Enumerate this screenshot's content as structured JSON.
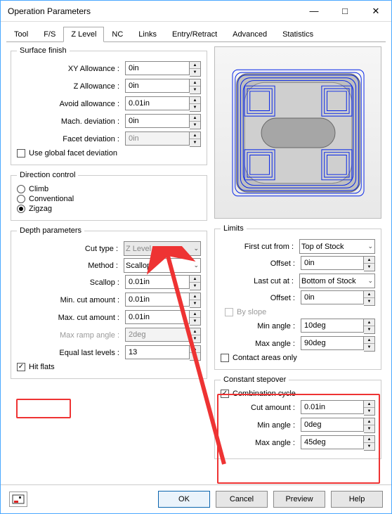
{
  "window": {
    "title": "Operation Parameters",
    "min": "—",
    "max": "□",
    "close": "✕"
  },
  "tabs": [
    "Tool",
    "F/S",
    "Z Level",
    "NC",
    "Links",
    "Entry/Retract",
    "Advanced",
    "Statistics"
  ],
  "active_tab": 2,
  "surface_finish": {
    "legend": "Surface finish",
    "xy_allow": {
      "label": "XY Allowance :",
      "value": "0in"
    },
    "z_allow": {
      "label": "Z Allowance :",
      "value": "0in"
    },
    "avoid": {
      "label": "Avoid allowance :",
      "value": "0.01in"
    },
    "mach_dev": {
      "label": "Mach. deviation :",
      "value": "0in"
    },
    "facet_dev": {
      "label": "Facet deviation :",
      "value": "0in"
    },
    "use_global": {
      "label": "Use global facet deviation",
      "checked": false
    }
  },
  "direction": {
    "legend": "Direction control",
    "opts": [
      "Climb",
      "Conventional",
      "Zigzag"
    ],
    "selected": 2
  },
  "depth": {
    "legend": "Depth parameters",
    "cut_type": {
      "label": "Cut type :",
      "value": "Z Level"
    },
    "method": {
      "label": "Method :",
      "value": "Scallop"
    },
    "scallop": {
      "label": "Scallop :",
      "value": "0.01in"
    },
    "min_cut": {
      "label": "Min. cut amount :",
      "value": "0.01in"
    },
    "max_cut": {
      "label": "Max. cut amount :",
      "value": "0.01in"
    },
    "max_ramp": {
      "label": "Max ramp angle :",
      "value": "2deg"
    },
    "equal_last": {
      "label": "Equal last levels :",
      "value": "13"
    },
    "hit_flats": {
      "label": "Hit flats",
      "checked": true
    }
  },
  "limits": {
    "legend": "Limits",
    "first_cut": {
      "label": "First cut from :",
      "value": "Top of Stock"
    },
    "offset1": {
      "label": "Offset :",
      "value": "0in"
    },
    "last_cut": {
      "label": "Last cut at :",
      "value": "Bottom of Stock"
    },
    "offset2": {
      "label": "Offset :",
      "value": "0in"
    },
    "by_slope": {
      "label": "By slope",
      "checked": false
    },
    "min_ang": {
      "label": "Min angle :",
      "value": "10deg"
    },
    "max_ang": {
      "label": "Max angle :",
      "value": "90deg"
    },
    "contact": {
      "label": "Contact areas only",
      "checked": false
    }
  },
  "const_step": {
    "legend": "Constant stepover",
    "combo": {
      "label": "Combination cycle",
      "checked": true
    },
    "cut_amt": {
      "label": "Cut amount :",
      "value": "0.01in"
    },
    "min_ang": {
      "label": "Min angle :",
      "value": "0deg"
    },
    "max_ang": {
      "label": "Max angle :",
      "value": "45deg"
    }
  },
  "footer": {
    "ok": "OK",
    "cancel": "Cancel",
    "preview": "Preview",
    "help": "Help"
  },
  "glyphs": {
    "up": "▲",
    "down": "▼",
    "chev": "⌄",
    "check": "✓"
  }
}
